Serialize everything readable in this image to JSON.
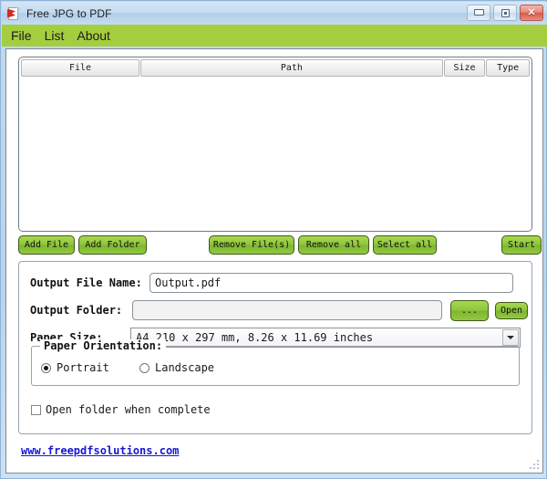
{
  "window": {
    "title": "Free JPG to PDF",
    "icon": "pdf-document-icon",
    "controls": {
      "minimize": "minimize-icon",
      "maximize": "maximize-icon",
      "close": "✕"
    }
  },
  "menubar": {
    "items": [
      {
        "label": "File"
      },
      {
        "label": "List"
      },
      {
        "label": "About"
      }
    ]
  },
  "filelist": {
    "columns": [
      {
        "label": "File"
      },
      {
        "label": "Path"
      },
      {
        "label": "Size"
      },
      {
        "label": "Type"
      }
    ],
    "rows": []
  },
  "actions": {
    "add_file": "Add File",
    "add_folder": "Add Folder",
    "remove_files": "Remove File(s)",
    "remove_all": "Remove all",
    "select_all": "Select all",
    "start": "Start"
  },
  "output": {
    "file_name_label": "Output File Name:",
    "file_name_value": "Output.pdf",
    "folder_label": "Output Folder:",
    "folder_value": "",
    "browse_button": "...",
    "open_button": "Open",
    "paper_size_label": "Paper Size:",
    "paper_size_value": "A4 210 x 297 mm, 8.26 x 11.69 inches"
  },
  "orientation": {
    "legend": "Paper Orientation:",
    "options": [
      {
        "label": "Portrait",
        "selected": true
      },
      {
        "label": "Landscape",
        "selected": false
      }
    ]
  },
  "open_folder": {
    "label": "Open folder when complete",
    "checked": false
  },
  "footer": {
    "link": "www.freepdfsolutions.com"
  },
  "colors": {
    "menubar_green": "#a4ce3e",
    "button_green": "#8fc63d",
    "link_blue": "#1717d6",
    "titlebar_blue": "#c6dcf0"
  }
}
